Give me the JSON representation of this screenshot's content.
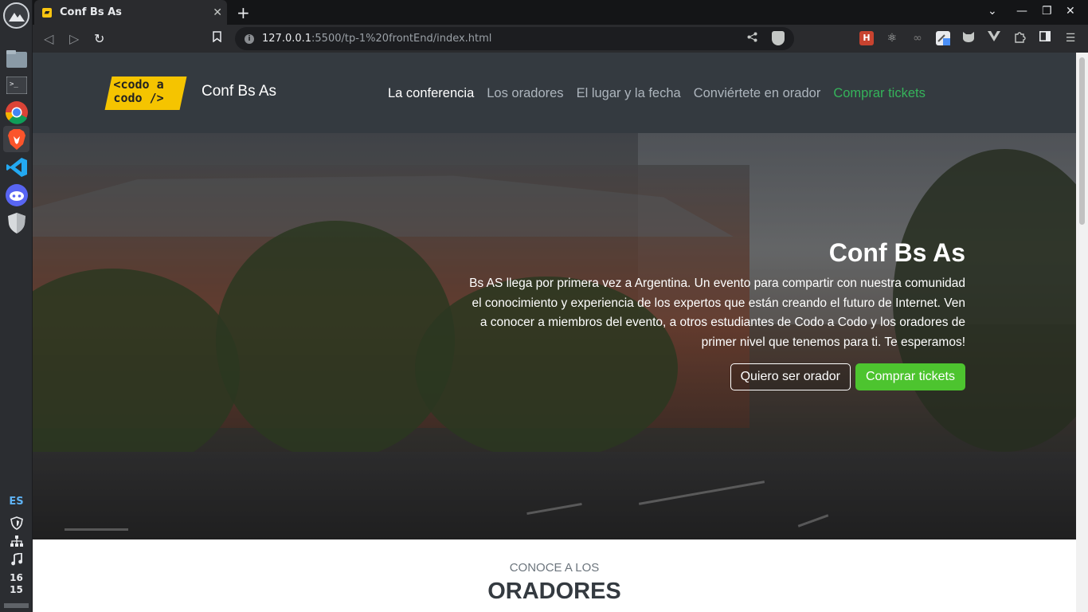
{
  "dock": {
    "language": "ES",
    "clock_hour": "16",
    "clock_minute": "15"
  },
  "browser": {
    "tab_title": "Conf Bs As",
    "url_host": "127.0.0.1",
    "url_path": ":5500/tp-1%20frontEnd/index.html"
  },
  "site": {
    "brand": "Conf Bs As",
    "logo_line1": "<codo a",
    "logo_line2": "codo />",
    "nav": [
      {
        "label": "La conferencia"
      },
      {
        "label": "Los oradores"
      },
      {
        "label": "El lugar y la fecha"
      },
      {
        "label": "Conviértete en orador"
      },
      {
        "label": "Comprar tickets"
      }
    ]
  },
  "hero": {
    "title": "Conf Bs As",
    "line1": "Bs AS llega por primera vez a Argentina. Un evento para compartir con nuestra comunidad",
    "line2": "el conocimiento y experiencia de los expertos que están creando el futuro de Internet. Ven",
    "line3": "a conocer a miembros del evento, a otros estudiantes de Codo a Codo y los oradores de",
    "line4": "primer nivel que tenemos para ti. Te esperamos!",
    "btn_speaker": "Quiero ser orador",
    "btn_tickets": "Comprar tickets"
  },
  "speakers": {
    "subtitle": "CONOCE A LOS",
    "title": "ORADORES"
  },
  "colors": {
    "nav_bg": "#343a40",
    "accent_green": "#4dc42f",
    "logo_yellow": "#f5c400"
  }
}
